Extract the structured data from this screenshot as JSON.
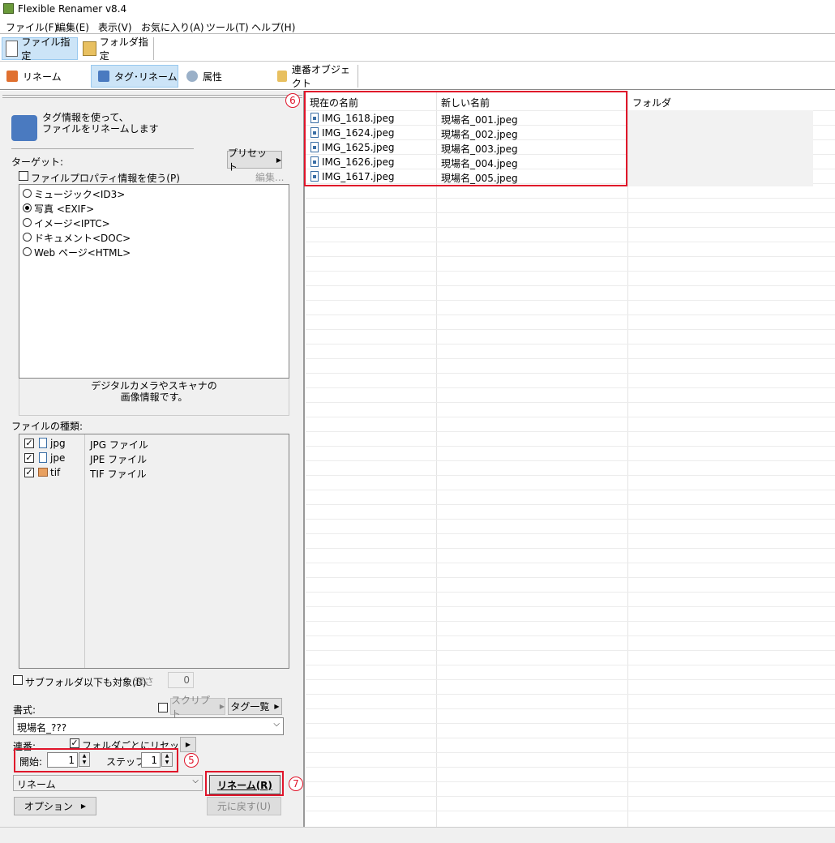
{
  "app": {
    "title": "Flexible Renamer v8.4"
  },
  "menu": [
    "ファイル(F)",
    "編集(E)",
    "表示(V)",
    "お気に入り(A)",
    "ツール(T)",
    "ヘルプ(H)"
  ],
  "toolbar1": {
    "file_mode": "ファイル指定",
    "folder_mode": "フォルダ指定"
  },
  "toolbar2": {
    "rename": "リネーム",
    "tag_rename": "タグ･リネーム",
    "attributes": "属性",
    "serial_object": "連番オブジェクト"
  },
  "left": {
    "description": "タグ情報を使って、\nファイルをリネームします",
    "target_label": "ターゲット:",
    "preset_button": "プリセット",
    "use_file_property": "ファイルプロパティ情報を使う(P)",
    "edit_link": "編集...",
    "target_options": [
      "ミュージック<ID3>",
      "写真 <EXIF>",
      "イメージ<IPTC>",
      "ドキュメント<DOC>",
      "Web ページ<HTML>"
    ],
    "selected_target": 1,
    "target_description": "デジタルカメラやスキャナの\n画像情報です。",
    "file_types_label": "ファイルの種類:",
    "file_types": [
      {
        "ext": "jpg",
        "desc": "JPG ファイル",
        "checked": true
      },
      {
        "ext": "jpe",
        "desc": "JPE ファイル",
        "checked": true
      },
      {
        "ext": "tif",
        "desc": "TIF ファイル",
        "checked": true
      }
    ],
    "subfolder_label": "サブフォルダ以下も対象(B)",
    "depth_label": "深さ",
    "depth_value": "0",
    "format_label": "書式:",
    "script_button": "スクリプト",
    "tag_list_button": "タグ一覧",
    "format_value": "現場名_???",
    "serial_label": "連番:",
    "reset_per_folder": "フォルダごとにリセット",
    "start_label": "開始:",
    "start_value": "1",
    "step_label": "ステップ:",
    "step_value": "1",
    "action_select": "リネーム",
    "rename_button": "リネーム(R)",
    "options_button": "オプション",
    "undo_button": "元に戻す(U)",
    "annot_5": "5",
    "annot_7": "7"
  },
  "right": {
    "annot_6": "6",
    "columns": [
      "現在の名前",
      "新しい名前",
      "フォルダ"
    ],
    "rows": [
      {
        "current": "IMG_1618.jpeg",
        "new": "現場名_001.jpeg"
      },
      {
        "current": "IMG_1624.jpeg",
        "new": "現場名_002.jpeg"
      },
      {
        "current": "IMG_1625.jpeg",
        "new": "現場名_003.jpeg"
      },
      {
        "current": "IMG_1626.jpeg",
        "new": "現場名_004.jpeg"
      },
      {
        "current": "IMG_1617.jpeg",
        "new": "現場名_005.jpeg"
      }
    ]
  }
}
